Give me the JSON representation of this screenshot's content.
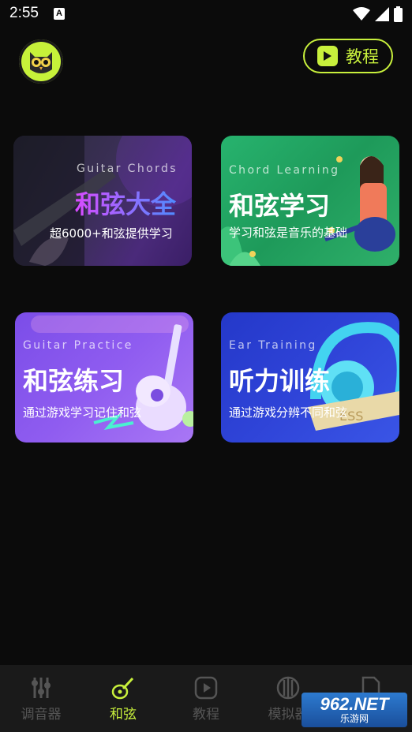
{
  "status_bar": {
    "time": "2:55",
    "notif_icon": "A"
  },
  "header": {
    "tutorial_label": "教程"
  },
  "cards": [
    {
      "en": "Guitar Chords",
      "zh": "和弦大全",
      "sub": "超6000+和弦提供学习"
    },
    {
      "en": "Chord Learning",
      "zh": "和弦学习",
      "sub": "学习和弦是音乐的基础"
    },
    {
      "en": "Guitar Practice",
      "zh": "和弦练习",
      "sub": "通过游戏学习记住和弦"
    },
    {
      "en": "Ear Training",
      "zh": "听力训练",
      "sub": "通过游戏分辨不同和弦"
    }
  ],
  "nav": [
    {
      "label": "调音器",
      "active": false
    },
    {
      "label": "和弦",
      "active": true
    },
    {
      "label": "教程",
      "active": false
    },
    {
      "label": "模拟器",
      "active": false
    }
  ],
  "watermark": {
    "top": "962.NET",
    "bottom": "乐游网"
  },
  "colors": {
    "accent": "#c8f03c",
    "background": "#0b0b0b",
    "nav_bg": "#1a1a1a",
    "inactive": "#555555"
  }
}
